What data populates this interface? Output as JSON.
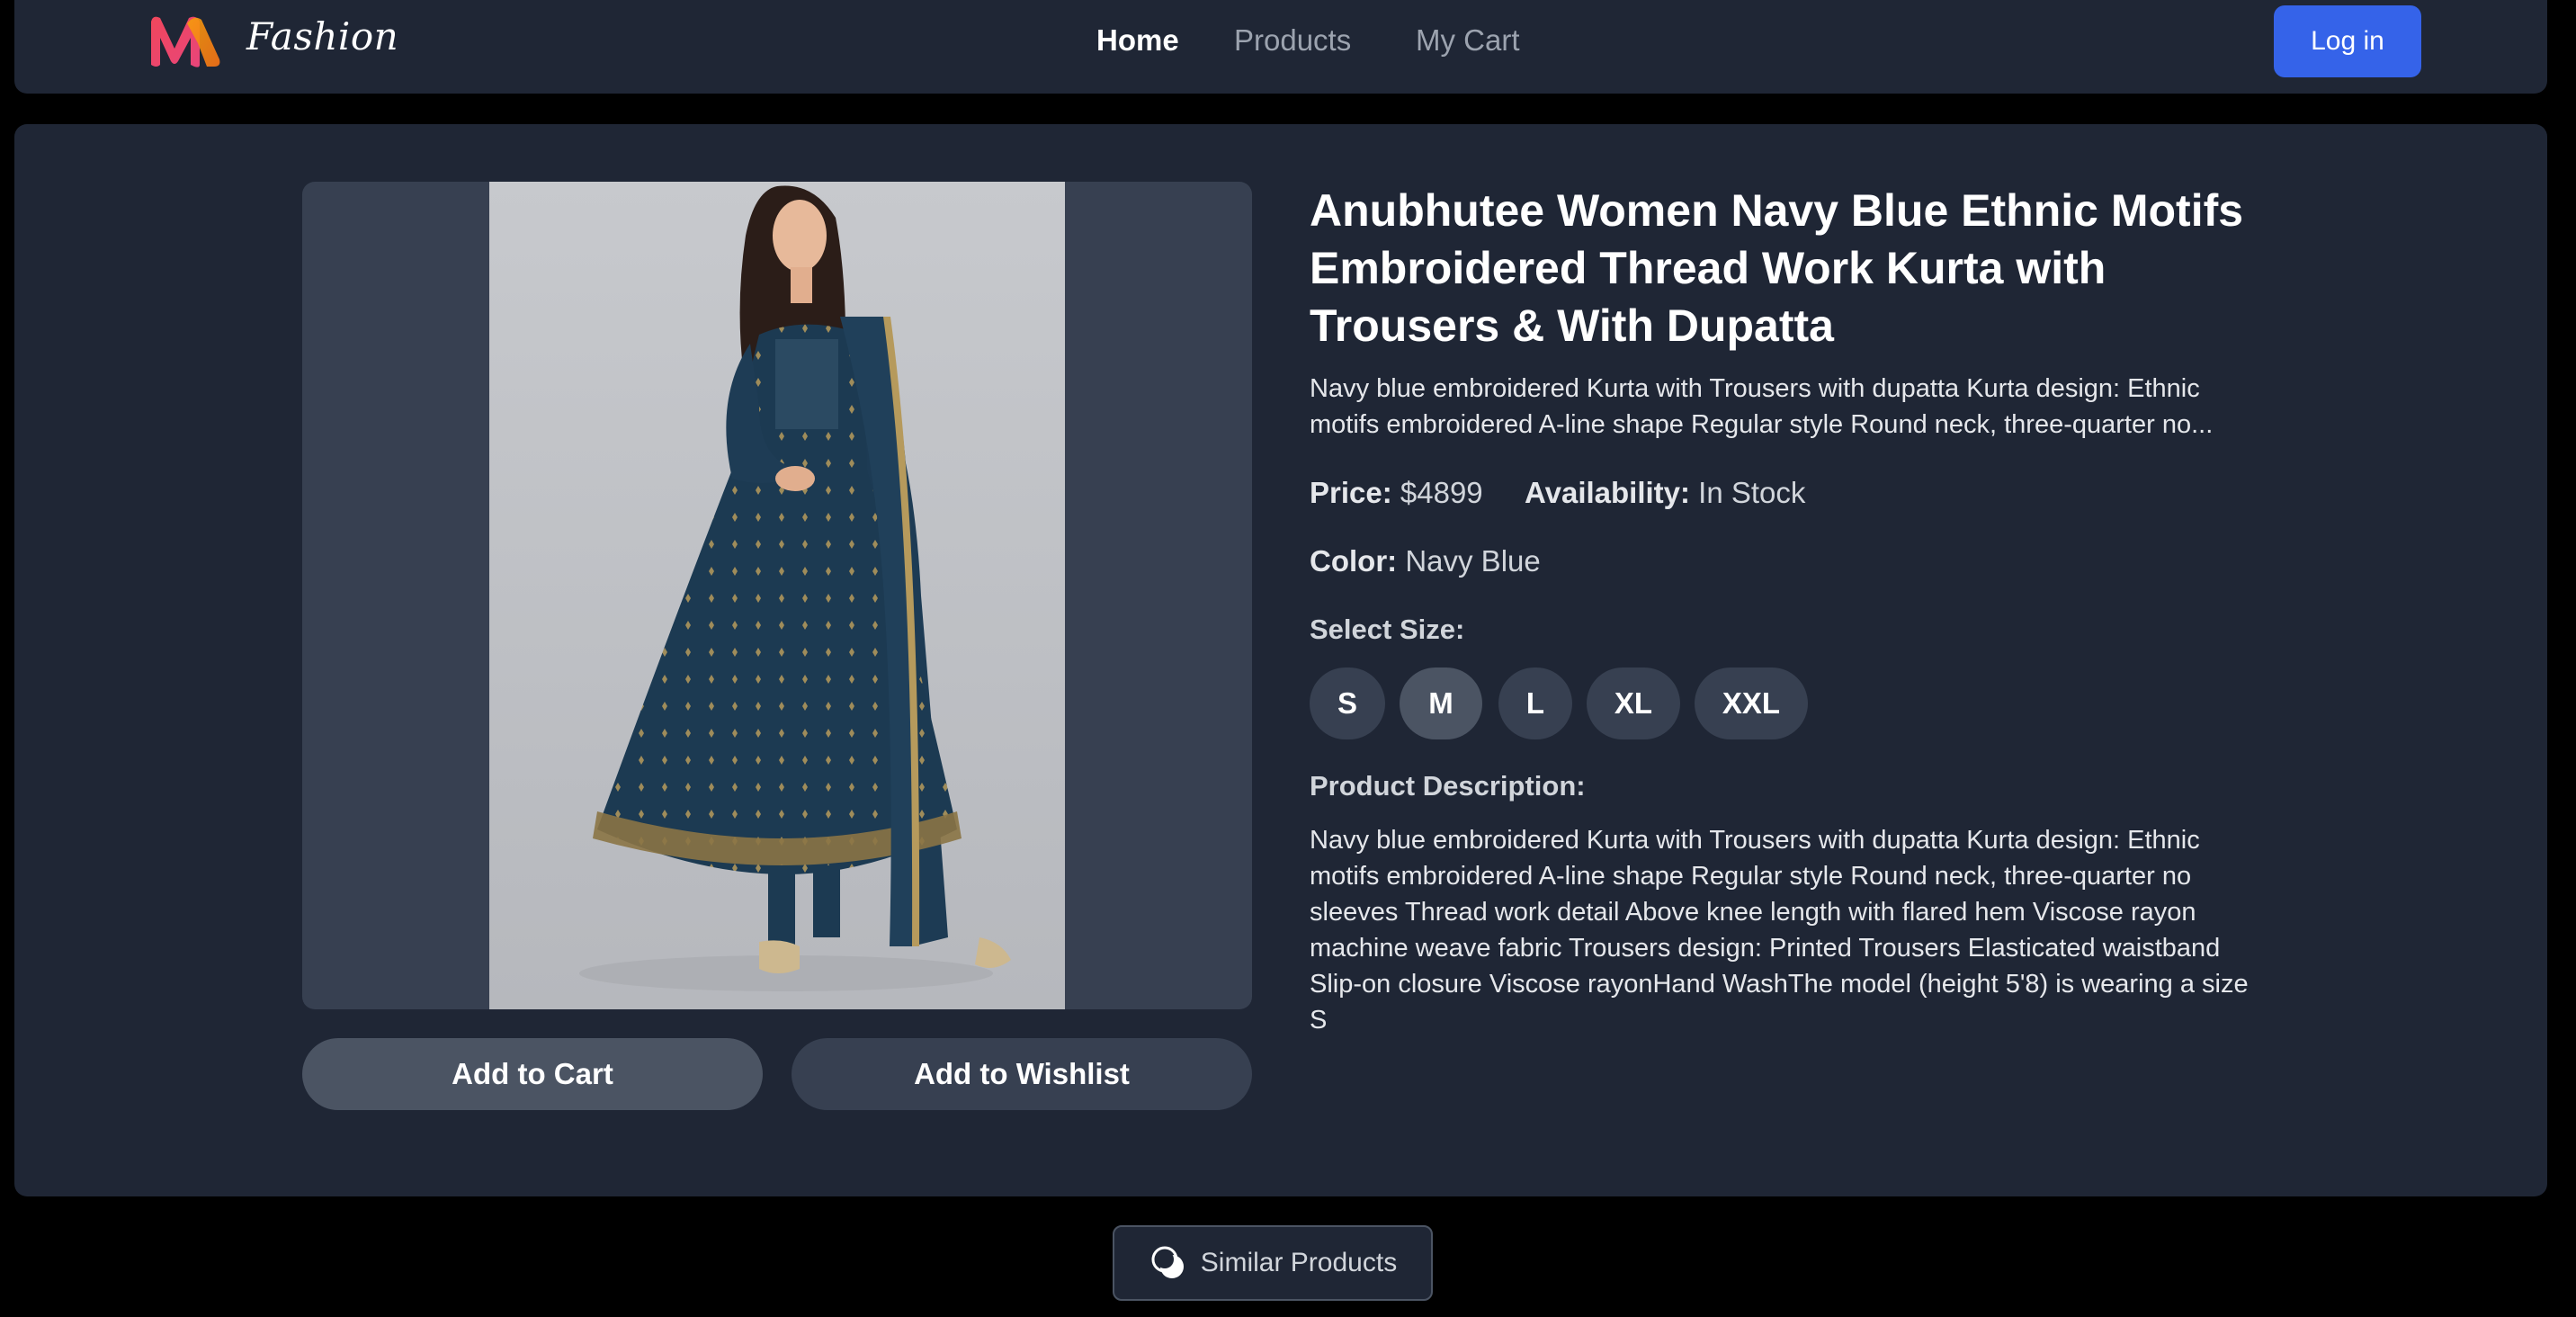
{
  "header": {
    "brand": "Fashion",
    "nav": [
      {
        "label": "Home",
        "active": true
      },
      {
        "label": "Products",
        "active": false
      },
      {
        "label": "My Cart",
        "active": false
      }
    ],
    "login_label": "Log in"
  },
  "product": {
    "title": "Anubhutee Women Navy Blue Ethnic Motifs Embroidered Thread Work Kurta with Trousers & With Dupatta",
    "short_description": "Navy blue embroidered Kurta with Trousers with dupatta Kurta design: Ethnic motifs embroidered A-line shape Regular style Round neck, three-quarter no...",
    "price_label": "Price:",
    "price": "$4899",
    "availability_label": "Availability:",
    "availability": "In Stock",
    "color_label": "Color:",
    "color": "Navy Blue",
    "select_size_label": "Select Size:",
    "sizes": [
      "S",
      "M",
      "L",
      "XL",
      "XXL"
    ],
    "selected_size": "M",
    "description_heading": "Product Description:",
    "description": "Navy blue embroidered Kurta with Trousers with dupatta Kurta design: Ethnic motifs embroidered A-line shape Regular style Round neck, three-quarter no sleeves Thread work detail Above knee length with flared hem Viscose rayon machine weave fabric Trousers design: Printed Trousers Elasticated waistband Slip-on closure Viscose rayonHand WashThe model (height 5'8) is wearing a size S"
  },
  "actions": {
    "add_to_cart": "Add to Cart",
    "add_to_wishlist": "Add to Wishlist"
  },
  "similar_products_label": "Similar Products",
  "colors": {
    "page_bg": "#000000",
    "panel_bg": "#1f2635",
    "image_bg": "#374051",
    "button_primary": "#3563e9",
    "size_selected": "#4b5463",
    "size_default": "#374051",
    "logo_gradient": [
      "#f0475c",
      "#f59e0b"
    ]
  },
  "icons": {
    "logo": "myntra-m-logo",
    "similar": "overlapping-circles-icon"
  }
}
